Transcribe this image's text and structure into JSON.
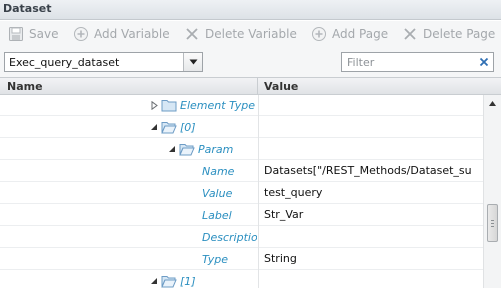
{
  "window": {
    "title": "Dataset"
  },
  "toolbar": {
    "save_label": "Save",
    "add_variable_label": "Add Variable",
    "delete_variable_label": "Delete Variable",
    "add_page_label": "Add Page",
    "delete_page_label": "Delete Page"
  },
  "dataset_select": {
    "value": "Exec_query_dataset"
  },
  "filter": {
    "placeholder": "Filter",
    "value": ""
  },
  "columns": {
    "name": "Name",
    "value": "Value"
  },
  "rows": [
    {
      "name": "Element Type",
      "value": "",
      "icon": "folder-icon",
      "expander": "collapsed"
    },
    {
      "name": "[0]",
      "value": "",
      "icon": "open-folder-icon",
      "expander": "expanded"
    },
    {
      "name": "Param",
      "value": "",
      "icon": "open-folder-icon",
      "expander": "expanded"
    },
    {
      "name": "Name",
      "value": "Datasets[\"/REST_Methods/Dataset_su",
      "icon": "",
      "expander": "none"
    },
    {
      "name": "Value",
      "value": "test_query",
      "icon": "",
      "expander": "none"
    },
    {
      "name": "Label",
      "value": "Str_Var",
      "icon": "",
      "expander": "none"
    },
    {
      "name": "Description",
      "value": "",
      "icon": "",
      "expander": "none"
    },
    {
      "name": "Type",
      "value": "String",
      "icon": "",
      "expander": "none"
    },
    {
      "name": "[1]",
      "value": "",
      "icon": "open-folder-icon",
      "expander": "expanded"
    }
  ],
  "colors": {
    "link_text": "#2b8fc0",
    "disabled_text": "#a4a8ac",
    "header_bg": "#e0e3e6",
    "folder": "#7fb0d8"
  }
}
